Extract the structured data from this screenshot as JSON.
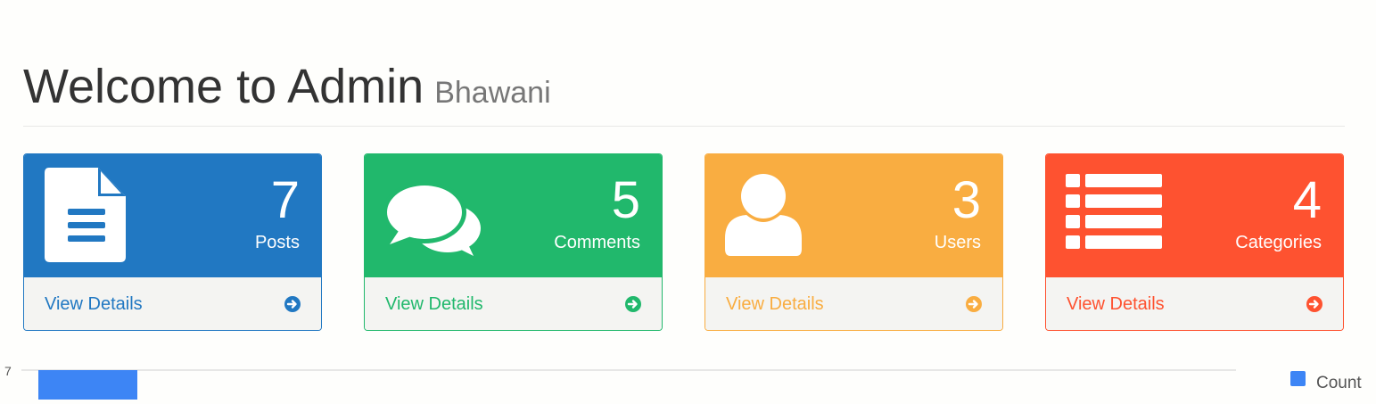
{
  "header": {
    "title": "Welcome to Admin",
    "subtitle": "Bhawani"
  },
  "panels": [
    {
      "count": "7",
      "label": "Posts",
      "link": "View Details",
      "color": "#2178c2",
      "icon": "file-text-icon"
    },
    {
      "count": "5",
      "label": "Comments",
      "link": "View Details",
      "color": "#21b86c",
      "icon": "comments-icon"
    },
    {
      "count": "3",
      "label": "Users",
      "link": "View Details",
      "color": "#f9ad41",
      "icon": "user-icon"
    },
    {
      "count": "4",
      "label": "Categories",
      "link": "View Details",
      "color": "#fe5230",
      "icon": "list-icon"
    }
  ],
  "chart_data": {
    "type": "bar",
    "categories": [],
    "series": [
      {
        "name": "Count",
        "values": [
          7
        ],
        "color": "#3d85f5"
      }
    ],
    "y_ticks": [
      "7"
    ],
    "legend": "right"
  }
}
